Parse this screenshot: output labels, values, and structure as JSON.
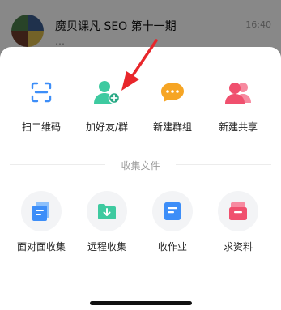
{
  "background_chat": {
    "title": "魔贝课凡 SEO 第十一期",
    "time": "16:40",
    "subtitle": "…"
  },
  "share_sheet": {
    "top_actions": [
      {
        "label": "扫二维码",
        "icon": "scan-qr-icon"
      },
      {
        "label": "加好友/群",
        "icon": "add-friend-icon"
      },
      {
        "label": "新建群组",
        "icon": "new-group-chat-icon"
      },
      {
        "label": "新建共享",
        "icon": "new-share-icon"
      }
    ],
    "section_title": "收集文件",
    "collect_actions": [
      {
        "label": "面对面收集",
        "icon": "face-to-face-collect-icon"
      },
      {
        "label": "远程收集",
        "icon": "remote-collect-icon"
      },
      {
        "label": "收作业",
        "icon": "homework-icon"
      },
      {
        "label": "求资料",
        "icon": "request-materials-icon"
      }
    ]
  },
  "colors": {
    "accent_blue": "#3d8ef8",
    "accent_green": "#3ecaa0",
    "accent_orange": "#f6a524",
    "accent_red": "#f0506e",
    "arrow_red": "#e8262b"
  }
}
